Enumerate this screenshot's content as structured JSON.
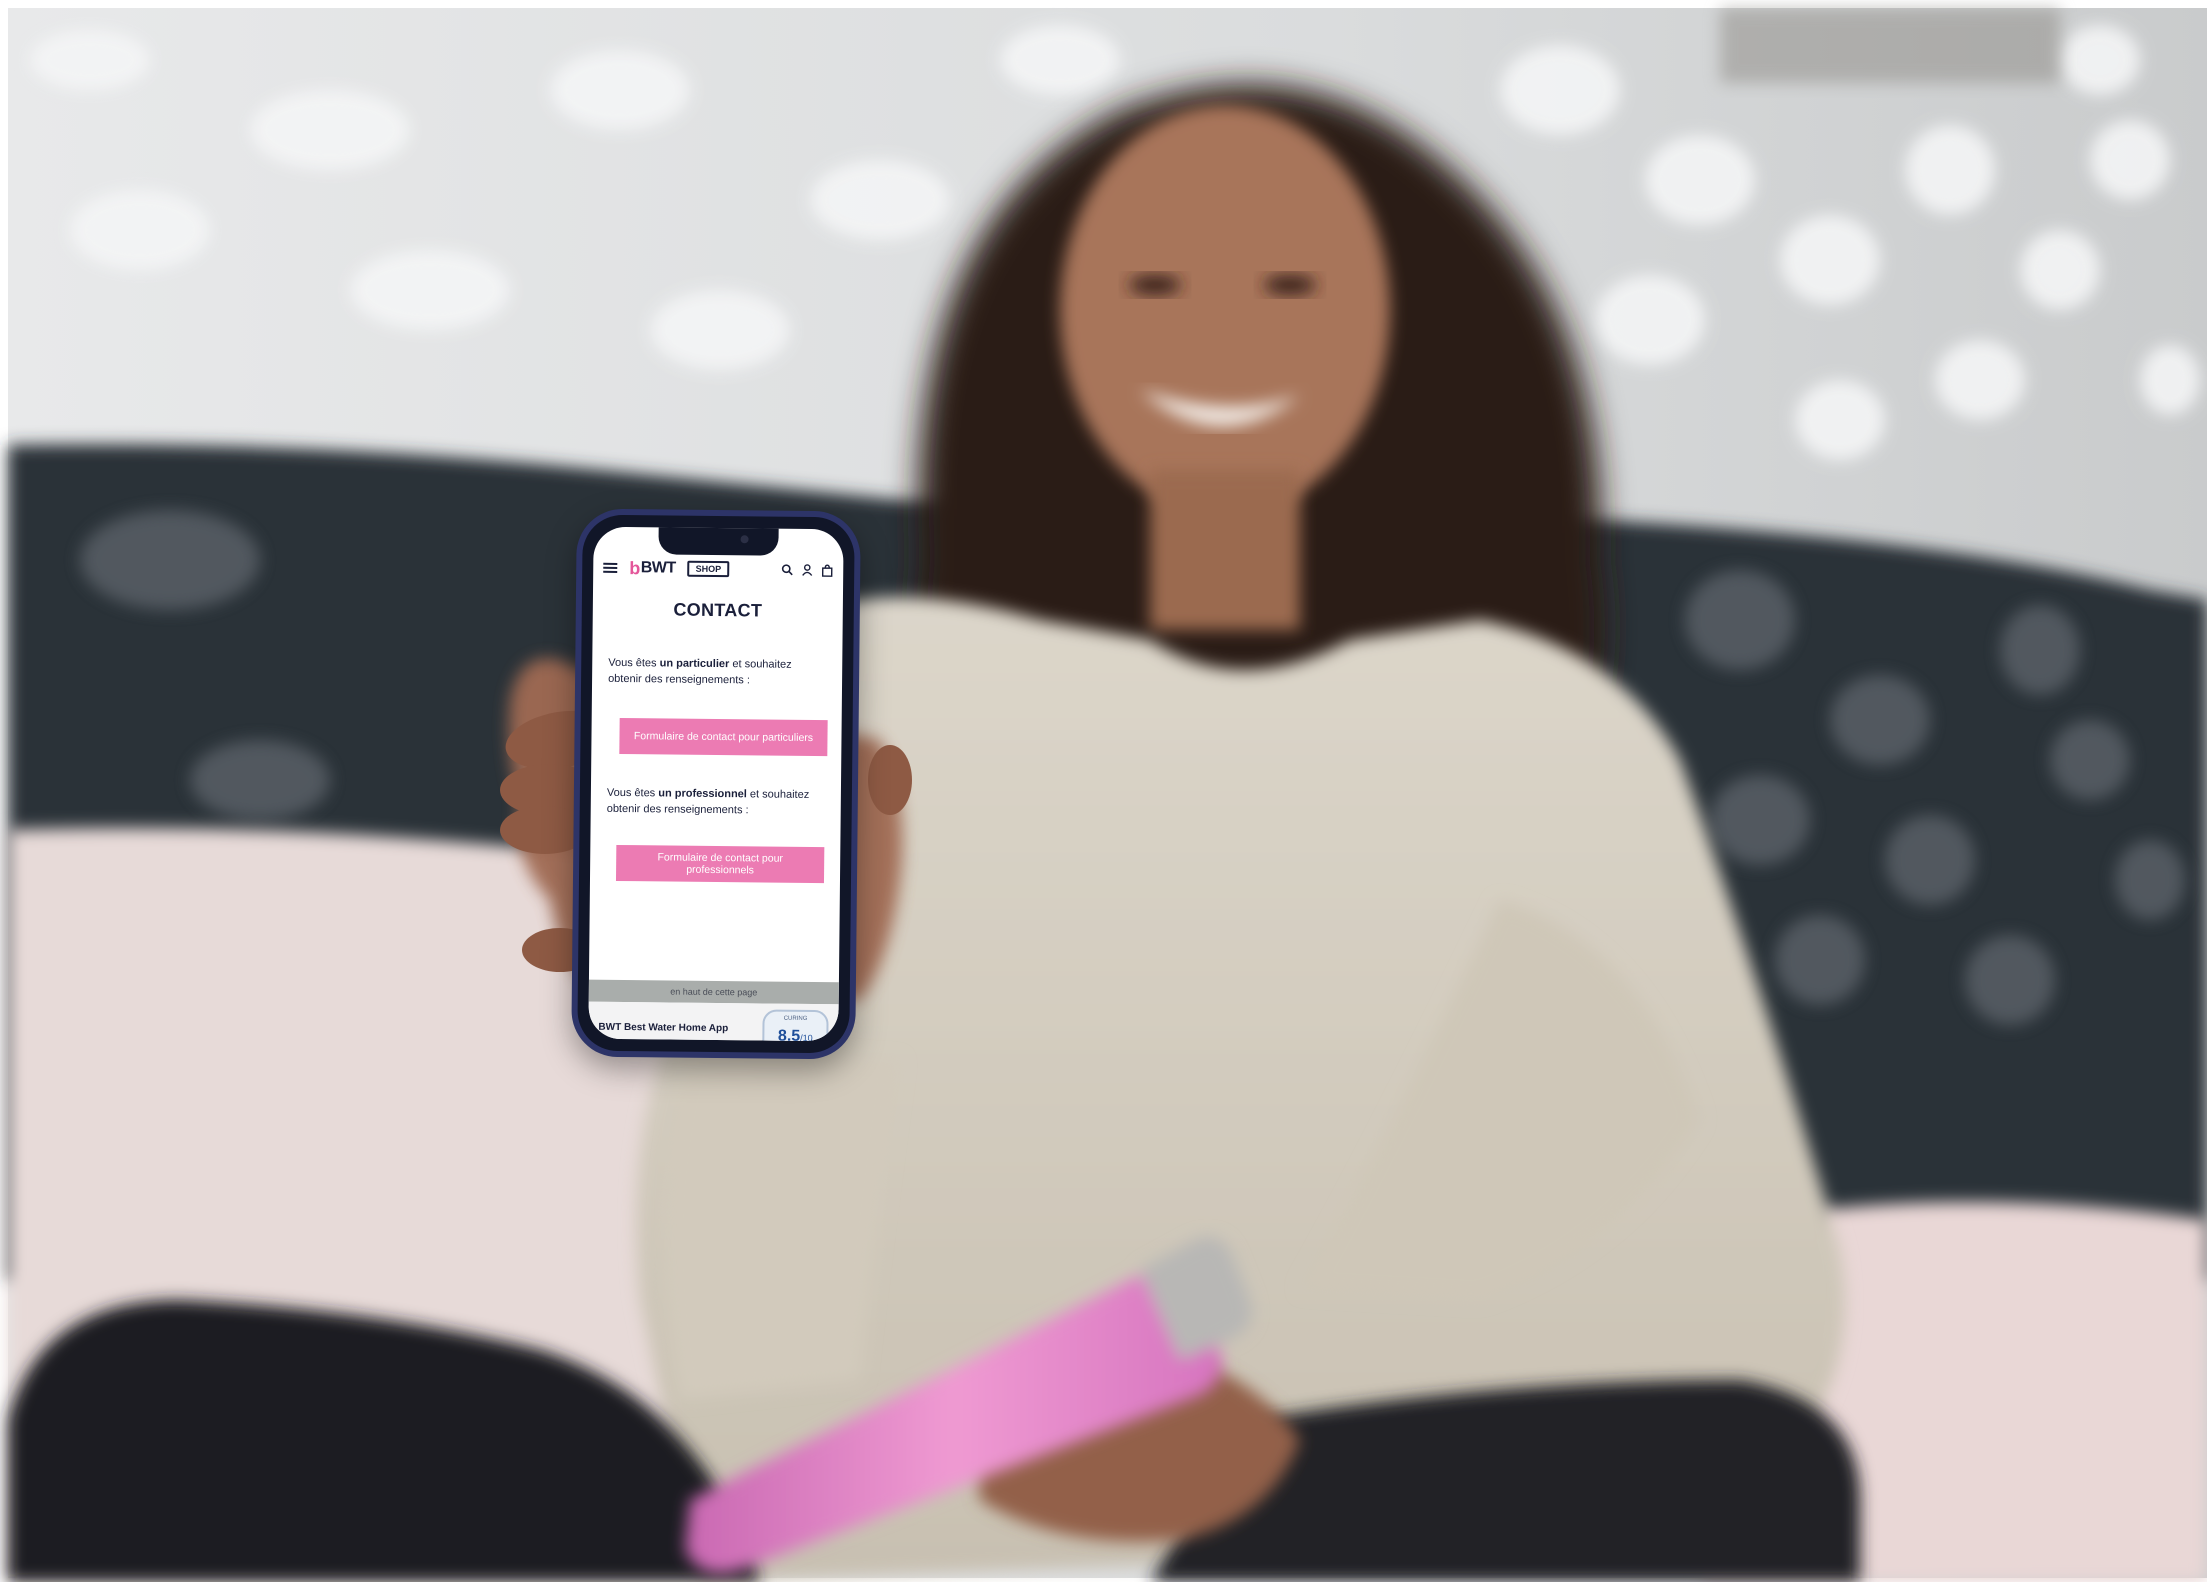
{
  "photo": {
    "description_icons": [
      "woman-figure",
      "pink-water-bottle",
      "sofa",
      "polka-dot-wall"
    ],
    "colors": {
      "bottle": "#e98ac4",
      "sweater": "#d9d2c4",
      "sofa": "#2a2f36",
      "accent_pink": "#ec7bb3",
      "phone_frame": "#2d3468"
    }
  },
  "phone": {
    "header": {
      "logo_b": "b",
      "logo_text": "BWT",
      "shop_label": "SHOP",
      "icons": [
        "menu-icon",
        "search-icon",
        "user-icon",
        "bag-icon"
      ]
    },
    "title": "CONTACT",
    "section_private": {
      "text_before": "Vous êtes ",
      "text_bold": "un particulier",
      "text_after": " et souhaitez obtenir des renseignements :",
      "button_label": "Formulaire de contact pour particuliers"
    },
    "section_pro": {
      "text_before": "Vous êtes ",
      "text_bold": "un professionnel",
      "text_after": " et souhaitez obtenir des renseignements :",
      "button_label": "Formulaire de contact pour professionnels"
    },
    "footer": {
      "back_to_top": "en haut de cette page",
      "app_name": "BWT Best Water Home App",
      "badge_label": "CURING",
      "score": "8.5",
      "score_max": "/10"
    }
  }
}
